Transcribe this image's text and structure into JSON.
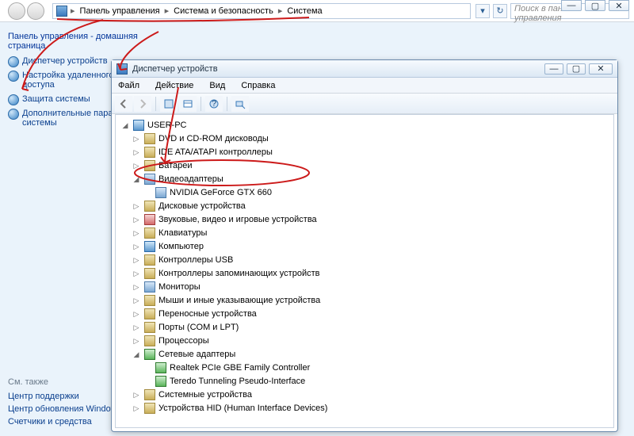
{
  "parent": {
    "breadcrumb": [
      "Панель управления",
      "Система и безопасность",
      "Система"
    ],
    "search_placeholder": "Поиск в панели управления"
  },
  "sidebar": {
    "heading": "Панель управления - домашняя страница",
    "items": [
      "Диспетчер устройств",
      "Настройка удаленного доступа",
      "Защита системы",
      "Дополнительные параметры системы"
    ]
  },
  "seealso": {
    "heading": "См. также",
    "items": [
      "Центр поддержки",
      "Центр обновления Windows",
      "Счетчики и средства"
    ]
  },
  "dm": {
    "title": "Диспетчер устройств",
    "menu": [
      "Файл",
      "Действие",
      "Вид",
      "Справка"
    ],
    "root": "USER-PC",
    "categories": [
      {
        "label": "DVD и CD-ROM дисководы"
      },
      {
        "label": "IDE ATA/ATAPI контроллеры"
      },
      {
        "label": "Батареи"
      },
      {
        "label": "Видеоадаптеры",
        "expanded": true,
        "children": [
          "NVIDIA GeForce GTX 660"
        ]
      },
      {
        "label": "Дисковые устройства"
      },
      {
        "label": "Звуковые, видео и игровые устройства"
      },
      {
        "label": "Клавиатуры"
      },
      {
        "label": "Компьютер"
      },
      {
        "label": "Контроллеры USB"
      },
      {
        "label": "Контроллеры запоминающих устройств"
      },
      {
        "label": "Мониторы"
      },
      {
        "label": "Мыши и иные указывающие устройства"
      },
      {
        "label": "Переносные устройства"
      },
      {
        "label": "Порты (COM и LPT)"
      },
      {
        "label": "Процессоры"
      },
      {
        "label": "Сетевые адаптеры",
        "expanded": true,
        "children": [
          "Realtek PCIe GBE Family Controller",
          "Teredo Tunneling Pseudo-Interface"
        ]
      },
      {
        "label": "Системные устройства"
      },
      {
        "label": "Устройства HID (Human Interface Devices)"
      }
    ]
  }
}
